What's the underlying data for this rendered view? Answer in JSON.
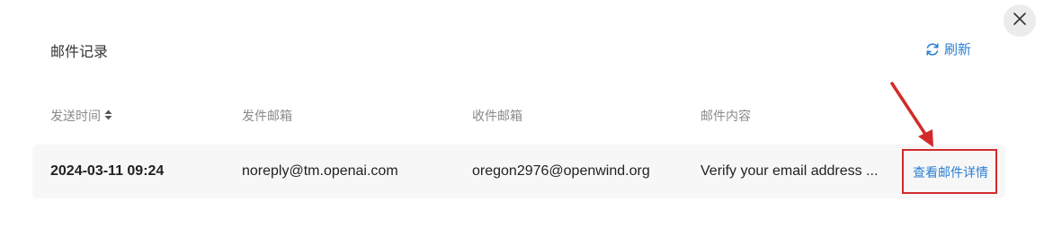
{
  "header": {
    "title": "邮件记录",
    "refresh_label": "刷新"
  },
  "icons": {
    "close": "close-icon",
    "refresh": "refresh-icon",
    "sort": "sort-icon"
  },
  "colors": {
    "accent": "#2a7fd1",
    "annotation": "#d22a2a",
    "row_background": "#f7f7f7"
  },
  "table": {
    "columns": [
      "发送时间",
      "发件邮箱",
      "收件邮箱",
      "邮件内容"
    ],
    "rows": [
      {
        "sent_time": "2024-03-11 09:24",
        "from": "noreply@tm.openai.com",
        "to": "oregon2976@openwind.org",
        "content": "Verify your email address ...",
        "action": "查看邮件详情"
      }
    ]
  }
}
